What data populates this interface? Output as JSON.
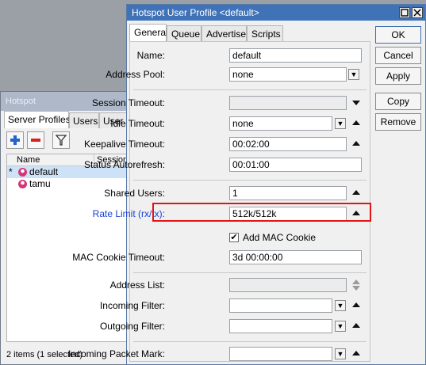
{
  "bg_window": {
    "title": "Hotspot",
    "tabs": [
      "Server Profiles",
      "Users",
      "User"
    ],
    "columns": [
      "Name",
      "Session"
    ],
    "rows": [
      {
        "marker": "*",
        "name": "default"
      },
      {
        "marker": "",
        "name": "tamu"
      }
    ],
    "status": "2 items (1 selected)"
  },
  "dialog": {
    "title": "Hotspot User Profile <default>",
    "tabs": [
      "General",
      "Queue",
      "Advertise",
      "Scripts"
    ],
    "buttons": {
      "ok": "OK",
      "cancel": "Cancel",
      "apply": "Apply",
      "copy": "Copy",
      "remove": "Remove"
    },
    "fields": {
      "name": {
        "label": "Name:",
        "value": "default"
      },
      "address_pool": {
        "label": "Address Pool:",
        "value": "none"
      },
      "session_timeout": {
        "label": "Session Timeout:",
        "value": ""
      },
      "idle_timeout": {
        "label": "Idle Timeout:",
        "value": "none"
      },
      "keepalive_timeout": {
        "label": "Keepalive Timeout:",
        "value": "00:02:00"
      },
      "status_autorefresh": {
        "label": "Status Autorefresh:",
        "value": "00:01:00"
      },
      "shared_users": {
        "label": "Shared Users:",
        "value": "1"
      },
      "rate_limit": {
        "label": "Rate Limit (rx/tx):",
        "value": "512k/512k"
      },
      "add_mac_cookie": {
        "label": "Add MAC Cookie",
        "checked": true
      },
      "mac_cookie_timeout": {
        "label": "MAC Cookie Timeout:",
        "value": "3d 00:00:00"
      },
      "address_list": {
        "label": "Address List:",
        "value": ""
      },
      "incoming_filter": {
        "label": "Incoming Filter:",
        "value": ""
      },
      "outgoing_filter": {
        "label": "Outgoing Filter:",
        "value": ""
      },
      "incoming_packet_mark": {
        "label": "Incoming Packet Mark:",
        "value": ""
      }
    }
  },
  "colors": {
    "title_active": "#3f72b7",
    "highlight": "#e11515",
    "link_label": "#1a3fd6"
  }
}
